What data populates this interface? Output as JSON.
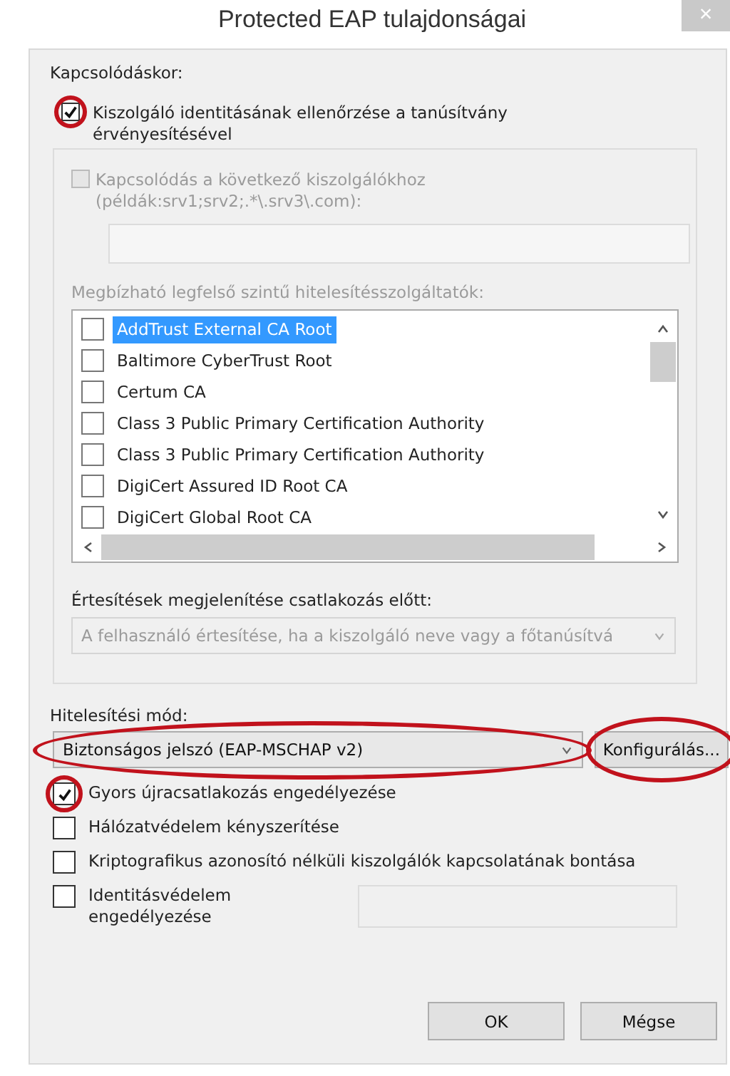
{
  "window": {
    "title": "Protected EAP tulajdonságai",
    "close": "×"
  },
  "connect_label": "Kapcsolódáskor:",
  "verify": {
    "label": "Kiszolgáló identitásának ellenőrzése a tanúsítvány érvényesítésével",
    "checked": true,
    "circled": true
  },
  "servers": {
    "label": "Kapcsolódás a következő kiszolgálókhoz (példák:srv1;srv2;.*\\.srv3\\.com):",
    "checked": false,
    "disabled": true
  },
  "ca_label": "Megbízható legfelső szintű hitelesítésszolgáltatók:",
  "ca_list": [
    {
      "name": "AddTrust External CA Root",
      "checked": false,
      "selected": true
    },
    {
      "name": "Baltimore CyberTrust Root",
      "checked": false,
      "selected": false
    },
    {
      "name": "Certum CA",
      "checked": false,
      "selected": false
    },
    {
      "name": "Class 3 Public Primary Certification Authority",
      "checked": false,
      "selected": false
    },
    {
      "name": "Class 3 Public Primary Certification Authority",
      "checked": false,
      "selected": false
    },
    {
      "name": "DigiCert Assured ID Root CA",
      "checked": false,
      "selected": false
    },
    {
      "name": "DigiCert Global Root CA",
      "checked": false,
      "selected": false
    }
  ],
  "notify": {
    "label": "Értesítések megjelenítése csatlakozás előtt:",
    "value": "A felhasználó értesítése, ha a kiszolgáló neve vagy a főtanúsítvá",
    "disabled": true
  },
  "auth": {
    "label": "Hitelesítési mód:",
    "value": "Biztonságos jelszó (EAP-MSCHAP v2)",
    "circled": true
  },
  "configure_button": {
    "label": "Konfigurálás...",
    "circled": true
  },
  "options": [
    {
      "kind": "checkbox",
      "label": "Gyors újracsatlakozás engedélyezése",
      "checked": true,
      "circled": true
    },
    {
      "kind": "checkbox",
      "label": "Hálózatvédelem kényszerítése",
      "checked": false,
      "circled": false
    },
    {
      "kind": "checkbox",
      "label": "Kriptografikus azonosító nélküli kiszolgálók kapcsolatának bontása",
      "checked": false,
      "circled": false
    },
    {
      "kind": "checkbox_field",
      "label": "Identitásvédelem engedélyezése",
      "checked": false,
      "circled": false
    }
  ],
  "buttons": [
    "OK",
    "Mégse"
  ]
}
